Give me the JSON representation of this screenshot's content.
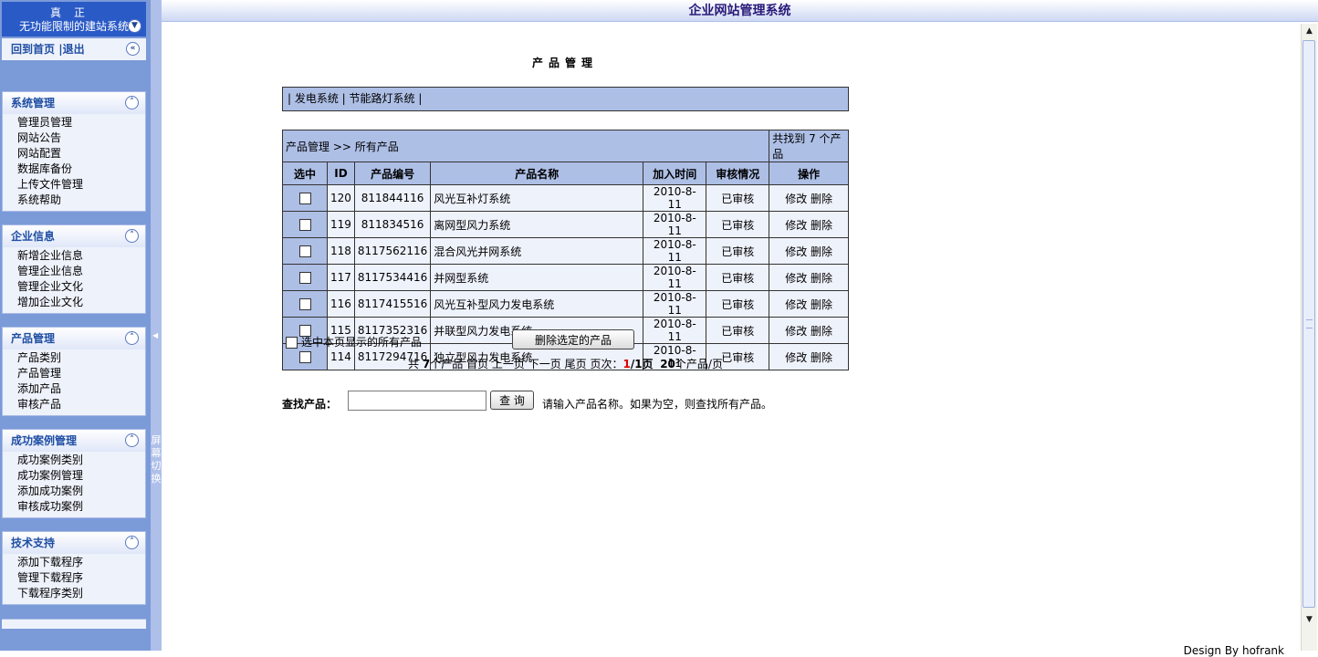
{
  "sidebar": {
    "brand_line1": "真正",
    "brand_line2": "无功能限制的建站系统",
    "home_link": "回到首页",
    "logout_link": "退出",
    "sections": [
      {
        "title": "系统管理",
        "items": [
          "管理员管理",
          "网站公告",
          "网站配置",
          "数据库备份",
          "上传文件管理",
          "系统帮助"
        ]
      },
      {
        "title": "企业信息",
        "items": [
          "新增企业信息",
          "管理企业信息",
          "管理企业文化",
          "增加企业文化"
        ]
      },
      {
        "title": "产品管理",
        "items": [
          "产品类别",
          "产品管理",
          "添加产品",
          "审核产品"
        ]
      },
      {
        "title": "成功案例管理",
        "items": [
          "成功案例类别",
          "成功案例管理",
          "添加成功案例",
          "审核成功案例"
        ]
      },
      {
        "title": "技术支持",
        "items": [
          "添加下载程序",
          "管理下载程序",
          "下载程序类别"
        ]
      }
    ]
  },
  "splitter": {
    "label": "屏幕切换"
  },
  "header": {
    "title": "企业网站管理系统"
  },
  "main": {
    "page_title": "产品管理",
    "category_bar": "| 发电系统 | 节能路灯系统 |",
    "breadcrumb": "产品管理 >> 所有产品",
    "found_count": "共找到 7 个产品",
    "columns": [
      "选中",
      "ID",
      "产品编号",
      "产品名称",
      "加入时间",
      "审核情况",
      "操作"
    ],
    "rows": [
      {
        "id": "120",
        "code": "811844116",
        "name": "风光互补灯系统",
        "date": "2010-8-11",
        "status": "已审核"
      },
      {
        "id": "119",
        "code": "811834516",
        "name": "离网型风力系统",
        "date": "2010-8-11",
        "status": "已审核"
      },
      {
        "id": "118",
        "code": "8117562116",
        "name": "混合风光并网系统",
        "date": "2010-8-11",
        "status": "已审核"
      },
      {
        "id": "117",
        "code": "8117534416",
        "name": "并网型系统",
        "date": "2010-8-11",
        "status": "已审核"
      },
      {
        "id": "116",
        "code": "8117415516",
        "name": "风光互补型风力发电系统",
        "date": "2010-8-11",
        "status": "已审核"
      },
      {
        "id": "115",
        "code": "8117352316",
        "name": "并联型风力发电系统",
        "date": "2010-8-11",
        "status": "已审核"
      },
      {
        "id": "114",
        "code": "8117294716",
        "name": "独立型风力发电系统",
        "date": "2010-8-11",
        "status": "已审核"
      }
    ],
    "action_edit": "修改",
    "action_delete": "删除",
    "select_all_label": "选中本页显示的所有产品",
    "delete_button": "删除选定的产品",
    "pager": {
      "prefix": "共",
      "total": "7",
      "unit": "个产品",
      "first": "首页",
      "prev": "上一页",
      "next": "下一页",
      "last": "尾页",
      "page_label": "页次：",
      "current": "1",
      "total_pages": "/1页",
      "per_page": "20",
      "per_page_unit": "个产品/页"
    },
    "search": {
      "label": "查找产品：",
      "value": "",
      "button": "查 询",
      "hint": "请输入产品名称。如果为空，则查找所有产品。"
    },
    "footer": "Design By hofrank"
  }
}
